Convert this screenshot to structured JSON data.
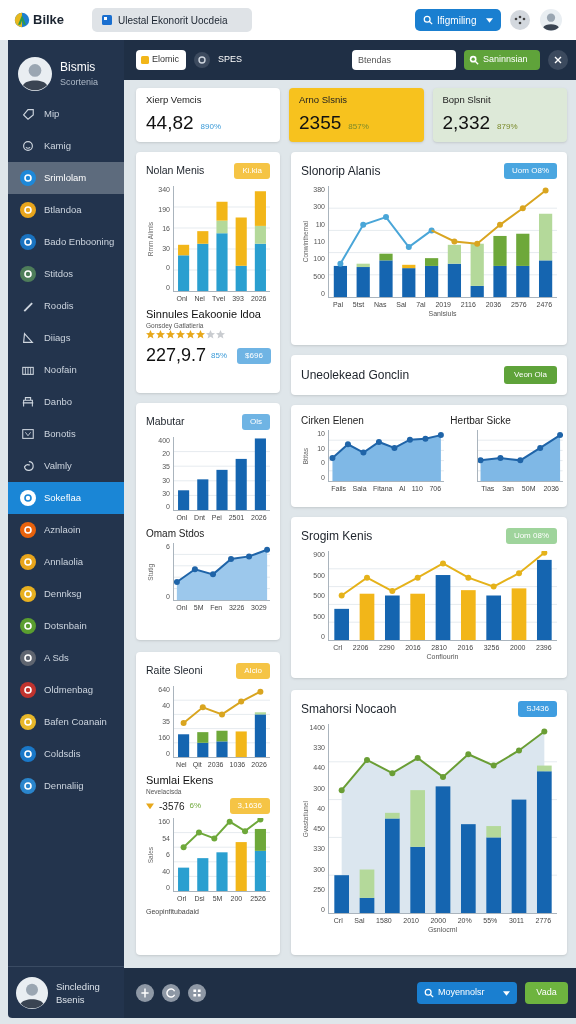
{
  "header": {
    "brand": "Bilke",
    "document_tab": "Ulestal Ekonorit Uocdeia",
    "user_button": "Ifigmiling"
  },
  "sidebar": {
    "profile": {
      "name": "Bismis",
      "role": "Scortenia"
    },
    "items": [
      {
        "label": "Mip",
        "kind": "line",
        "selected": false,
        "hovered": false
      },
      {
        "label": "Kamig",
        "kind": "line",
        "selected": false,
        "hovered": false
      },
      {
        "label": "Srimlolam",
        "kind": "dot",
        "color": "#1e88d8",
        "selected": false,
        "hovered": true
      },
      {
        "label": "Btlandoa",
        "kind": "dot",
        "color": "#e8a51c",
        "selected": false,
        "hovered": false
      },
      {
        "label": "Bado Enbooning",
        "kind": "dot",
        "color": "#1a73c0",
        "selected": false,
        "hovered": false
      },
      {
        "label": "Stitdos",
        "kind": "dot",
        "color": "#4e7d5a",
        "selected": false,
        "hovered": false
      },
      {
        "label": "Roodis",
        "kind": "line",
        "selected": false,
        "hovered": false
      },
      {
        "label": "Diiags",
        "kind": "line",
        "selected": false,
        "hovered": false
      },
      {
        "label": "Noofain",
        "kind": "line",
        "selected": false,
        "hovered": false
      },
      {
        "label": "Danbo",
        "kind": "line",
        "selected": false,
        "hovered": false
      },
      {
        "label": "Bonotis",
        "kind": "line",
        "selected": false,
        "hovered": false
      },
      {
        "label": "Valmly",
        "kind": "line",
        "selected": false,
        "hovered": false
      },
      {
        "label": "Sokeflaa",
        "kind": "dot",
        "color": "#ffffff",
        "selected": true,
        "hovered": false
      },
      {
        "label": "Aznlaoin",
        "kind": "dot",
        "color": "#e8620c",
        "selected": false,
        "hovered": false
      },
      {
        "label": "Annlaolia",
        "kind": "dot",
        "color": "#e8a51c",
        "selected": false,
        "hovered": false
      },
      {
        "label": "Dennksg",
        "kind": "dot",
        "color": "#e8b020",
        "selected": false,
        "hovered": false
      },
      {
        "label": "Dotsnbain",
        "kind": "dot",
        "color": "#5a9e2f",
        "selected": false,
        "hovered": false
      },
      {
        "label": "A Sds",
        "kind": "dot",
        "color": "#5f6570",
        "selected": false,
        "hovered": false
      },
      {
        "label": "Oldmenbag",
        "kind": "dot",
        "color": "#c0332e",
        "selected": false,
        "hovered": false
      },
      {
        "label": "Bafen Coanain",
        "kind": "dot",
        "color": "#e8b82a",
        "selected": false,
        "hovered": false
      },
      {
        "label": "Coldsdis",
        "kind": "dot",
        "color": "#1a78c8",
        "selected": false,
        "hovered": false
      },
      {
        "label": "Dennaliig",
        "kind": "dot",
        "color": "#2a85cc",
        "selected": false,
        "hovered": false
      }
    ],
    "footer_user": {
      "name": "Sincleding",
      "role": "Bsenis"
    }
  },
  "toolbar": {
    "filter_button": "Elomic",
    "label": "SPES",
    "search": {
      "placeholder": "Btendas"
    },
    "action_button": "Saninnsian"
  },
  "stats": [
    {
      "title": "Xierp Vemcis",
      "value": "44,82",
      "change": "890%",
      "color": "#ffffff"
    },
    {
      "title": "Arno Slsnis",
      "value": "2355",
      "change": "857%",
      "color": "#f7c21e"
    },
    {
      "title": "Bopn Slsnit",
      "value": "2,332",
      "change": "879%",
      "color": "#dde9d8"
    }
  ],
  "left_column": [
    {
      "sections": [
        {
          "kind": "heading",
          "title": "Nolan Menis",
          "badge": {
            "text": "Ki.kia",
            "color": "#f5c445"
          }
        },
        {
          "kind": "chart",
          "y_title": "Rmm Ailmls",
          "y_ticks": [
            "340",
            "190",
            "16",
            "30",
            "0",
            "0"
          ],
          "x_ticks": [
            "Onl",
            "Nel",
            "Tvel",
            "393",
            "2026"
          ]
        },
        {
          "kind": "metric",
          "title": "Sinnules Eakoonie ldoa",
          "subtitle": "Gonsdey Gatlatieria",
          "stars": 6,
          "value": "227,9.7",
          "change": "85%",
          "badge": {
            "text": "$696",
            "color": "#6fb4e4"
          },
          "trend_icon": false
        }
      ]
    },
    {
      "sections": [
        {
          "kind": "heading",
          "title": "Mabutar",
          "badge": {
            "text": "Ols",
            "color": "#6fb4e4"
          }
        },
        {
          "kind": "chart",
          "y_ticks": [
            "400",
            "20",
            "35",
            "30",
            "30",
            "0"
          ],
          "x_ticks": [
            "Onl",
            "Dnt",
            "Pei",
            "2501",
            "2026"
          ]
        },
        {
          "kind": "chart",
          "title": "Omam Stdos",
          "y_title": "Stutig",
          "y_ticks": [
            "6",
            "0"
          ],
          "x_ticks": [
            "Onl",
            "5M",
            "Fen",
            "3226",
            "3029"
          ]
        }
      ]
    },
    {
      "sections": [
        {
          "kind": "heading",
          "title": "Raite Sleoni",
          "badge": {
            "text": "AIcio",
            "color": "#f5c445"
          }
        },
        {
          "kind": "chart",
          "y_ticks": [
            "640",
            "40",
            "35",
            "160",
            "0"
          ],
          "x_ticks": [
            "Nel",
            "Qit",
            "2036",
            "1036",
            "2026"
          ]
        },
        {
          "kind": "metric",
          "title": "Sumlai Ekens",
          "subtitle": "Nevelacisda",
          "value": "-3576",
          "change": "6%",
          "badge": {
            "text": "3,1636",
            "color": "#f5c445"
          },
          "trend_icon": true
        },
        {
          "kind": "chart",
          "y_title": "Sales",
          "y_ticks": [
            "160",
            "54",
            "6",
            "40",
            "0"
          ],
          "x_ticks": [
            "Orl",
            "Dsi",
            "5M",
            "200",
            "2526"
          ]
        },
        {
          "kind": "note",
          "text": "Geopinfitubadaid"
        }
      ]
    }
  ],
  "right_column": [
    {
      "sections": [
        {
          "kind": "heading",
          "title": "Slonorip Alanis",
          "badge": {
            "text": "Uom O8%",
            "color": "#4aa6e0"
          }
        },
        {
          "kind": "chart",
          "y_title": "Conwinthemal",
          "x_title": "Sanlsiuls",
          "y_ticks": [
            "380",
            "300",
            "1l0",
            "110",
            "100",
            "500",
            "0"
          ],
          "x_ticks": [
            "Pal",
            "5tst",
            "Nas",
            "Sal",
            "7al",
            "2019",
            "2116",
            "2036",
            "2576",
            "2476"
          ]
        }
      ]
    },
    {
      "sections": [
        {
          "kind": "banner",
          "title": "Uneolekead Gonclin",
          "button": "Veon Ola"
        }
      ]
    },
    {
      "sections": [
        {
          "kind": "split",
          "charts": [
            {
              "title": "Cirken Elenen",
              "y_title": "Btitas",
              "y_ticks": [
                "10",
                "10",
                "0",
                "0"
              ],
              "x_ticks": [
                "Fails",
                "Sala",
                "Fitana",
                "Al",
                "110",
                "706"
              ]
            },
            {
              "title": "Hertbar Sicke",
              "x_ticks": [
                "Tias",
                "3an",
                "50M",
                "2036"
              ]
            }
          ]
        }
      ]
    },
    {
      "sections": [
        {
          "kind": "heading",
          "title": "Srogim Kenis",
          "badge": {
            "text": "Uom 08%",
            "color": "#9fd49c"
          }
        },
        {
          "kind": "chart",
          "x_title": "Confiourin",
          "y_ticks": [
            "900",
            "500",
            "500",
            "500",
            "0"
          ],
          "x_ticks": [
            "Crl",
            "2206",
            "2290",
            "2016",
            "2810",
            "2016",
            "3256",
            "2000",
            "2396"
          ]
        }
      ]
    },
    {
      "sections": [
        {
          "kind": "heading",
          "title": "Smahorsi Nocaoh",
          "badge": {
            "text": "SJ436",
            "color": "#3f9de0"
          }
        },
        {
          "kind": "chart",
          "y_title": "Gvastatiunel",
          "x_title": "Gsnlocml",
          "y_ticks": [
            "1400",
            "330",
            "440",
            "300",
            "40",
            "450",
            "330",
            "300",
            "250",
            "0"
          ],
          "x_ticks": [
            "Crl",
            "Sal",
            "1580",
            "2010",
            "2000",
            "20%",
            "55%",
            "3011",
            "2776"
          ]
        }
      ]
    }
  ],
  "footer": {
    "search_button": "Moyennolsr",
    "confirm_button": "Vada"
  }
}
